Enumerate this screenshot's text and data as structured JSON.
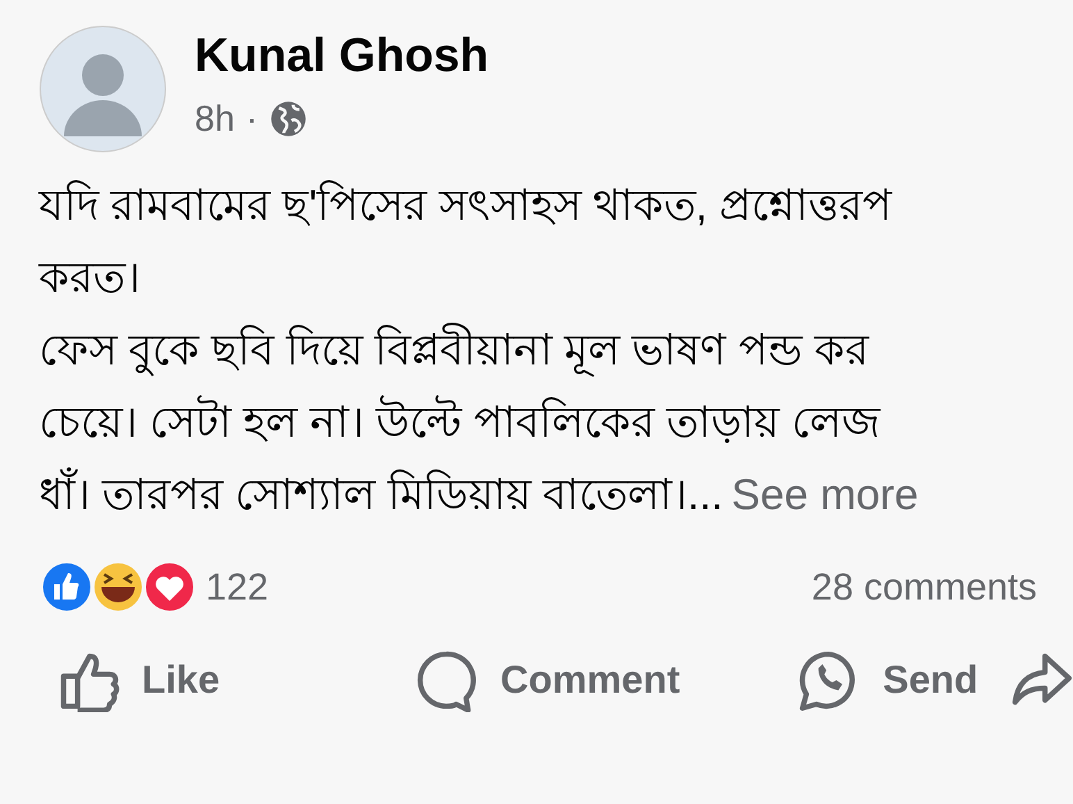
{
  "post": {
    "author": "Kunal Ghosh",
    "time": "8h",
    "separator": "·",
    "text_lines": [
      "যদি রামবামের ছ'পিসের সৎসাহস থাকত, প্রশ্নোত্তরপ",
      "করত।",
      "ফেস বুকে ছবি দিয়ে বিপ্লবীয়ানা মূল ভাষণ পন্ড কর",
      "চেয়ে। সেটা হল না। উল্টে পাবলিকের তাড়ায় লেজ",
      "ধাঁ। তারপর সোশ্যাল মিডিয়ায় বাতেলা।..."
    ],
    "see_more": "See more"
  },
  "reactions": {
    "count": "122"
  },
  "comments": "28 comments",
  "actions": [
    {
      "kind": "like",
      "label": "Like"
    },
    {
      "kind": "comment",
      "label": "Comment"
    },
    {
      "kind": "send",
      "label": "Send"
    },
    {
      "kind": "share"
    }
  ]
}
